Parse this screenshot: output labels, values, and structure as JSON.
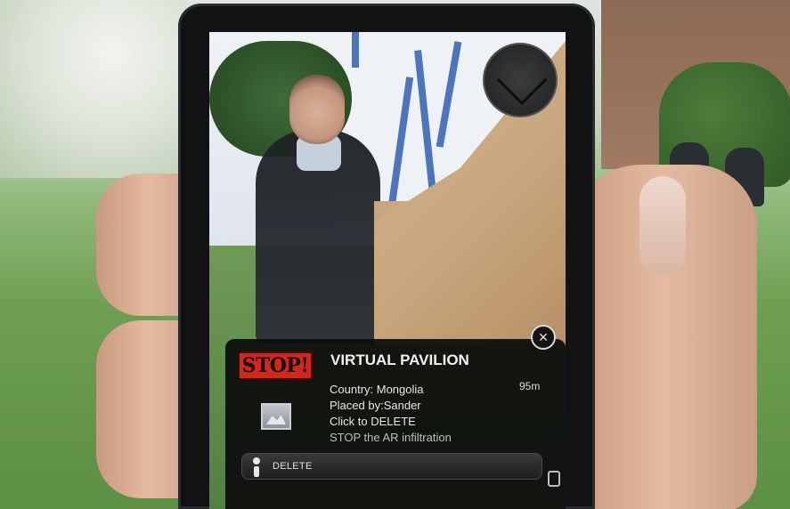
{
  "panel": {
    "logo_text": "STOP!",
    "title": "VIRTUAL PAVILION",
    "distance": "95m",
    "country": "Country: Mongolia",
    "placed_by": "Placed by:Sander",
    "click_to_delete": "Click to DELETE",
    "tagline": "STOP the AR infiltration",
    "close_glyph": "×",
    "delete_button_label": "DELETE"
  },
  "icons": {
    "close": "close-icon",
    "info": "info-icon",
    "thumbnail": "image-thumbnail-icon",
    "radar": "radar-icon"
  },
  "colors": {
    "stop_logo": "#d2271c",
    "panel_bg": "#0c0c0c"
  }
}
